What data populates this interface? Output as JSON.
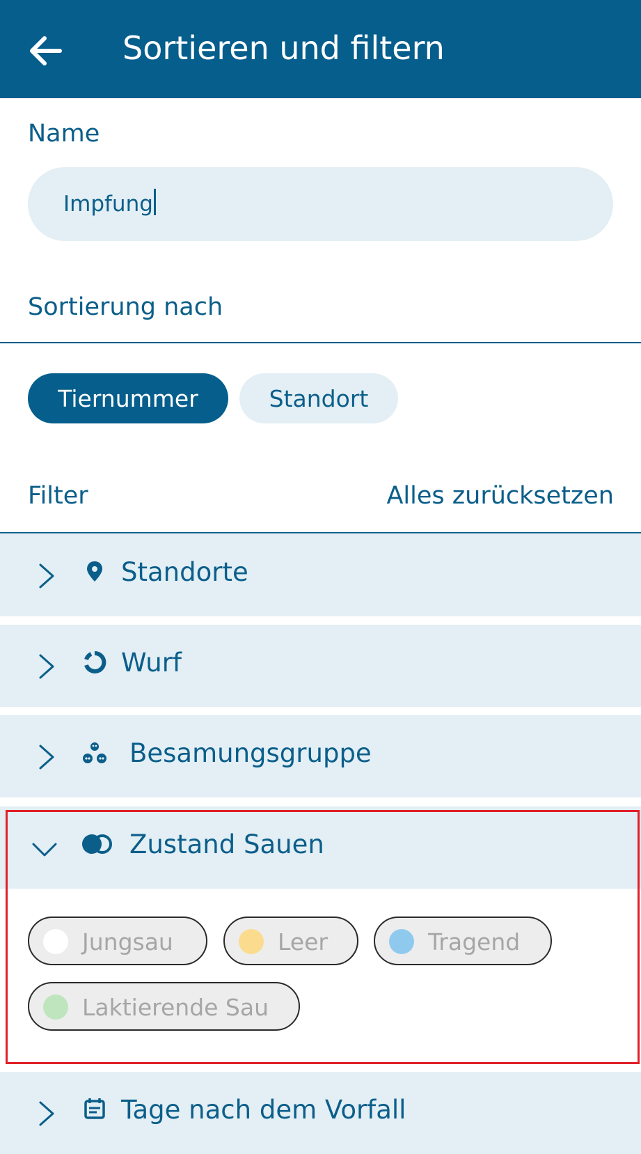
{
  "header": {
    "title": "Sortieren und filtern"
  },
  "name_section": {
    "label": "Name",
    "input_value": "Impfung"
  },
  "sort_section": {
    "label": "Sortierung nach",
    "options": [
      {
        "label": "Tiernummer",
        "selected": true
      },
      {
        "label": "Standort",
        "selected": false
      }
    ]
  },
  "filter_section": {
    "label": "Filter",
    "reset_label": "Alles zurücksetzen",
    "groups": [
      {
        "label": "Standorte",
        "icon": "location-pin-icon",
        "expanded": false
      },
      {
        "label": "Wurf",
        "icon": "cycle-icon",
        "expanded": false
      },
      {
        "label": "Besamungsgruppe",
        "icon": "group-icon",
        "expanded": false
      },
      {
        "label": "Zustand Sauen",
        "icon": "toggle-status-icon",
        "expanded": true
      },
      {
        "label": "Tage nach dem Vorfall",
        "icon": "calendar-icon",
        "expanded": false
      }
    ],
    "status_options": [
      {
        "label": "Jungsau",
        "color": "#ffffff"
      },
      {
        "label": "Leer",
        "color": "#fbdc8e"
      },
      {
        "label": "Tragend",
        "color": "#8fcaee"
      },
      {
        "label": "Laktierende Sau",
        "color": "#bfe5bf"
      }
    ]
  },
  "colors": {
    "primary": "#055e8c",
    "surface": "#e3eff5",
    "highlight_border": "#e0202a"
  }
}
